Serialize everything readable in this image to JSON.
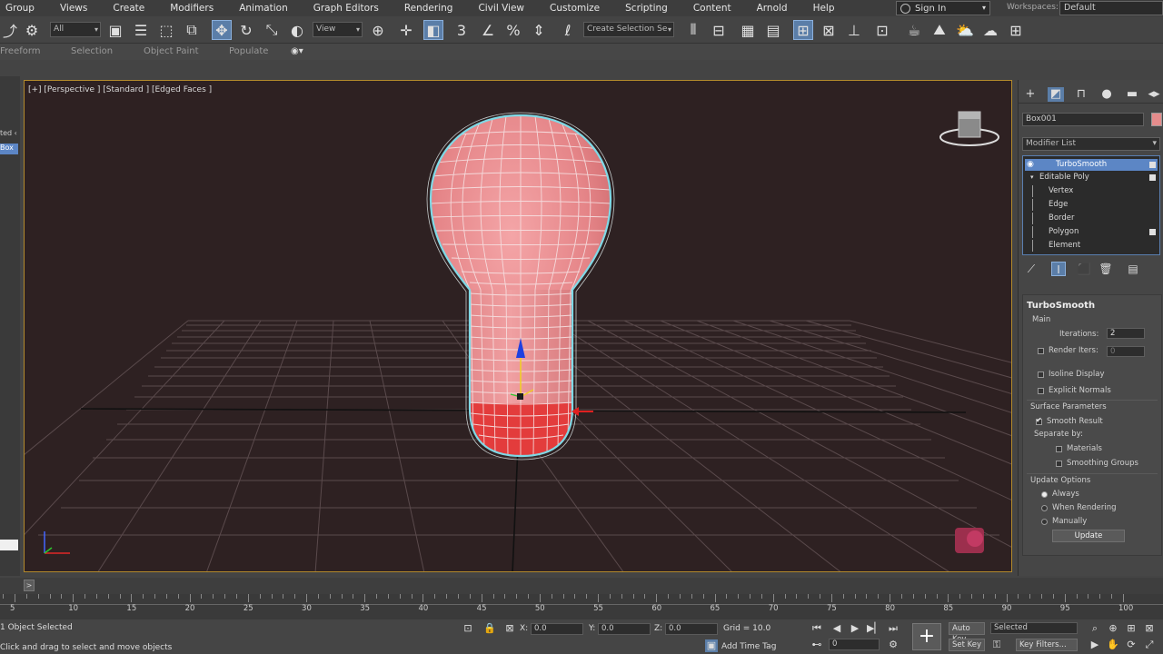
{
  "menu": [
    "Group",
    "Views",
    "Create",
    "Modifiers",
    "Animation",
    "Graph Editors",
    "Rendering",
    "Civil View",
    "Customize",
    "Scripting",
    "Content",
    "Arnold",
    "Help"
  ],
  "signin": "Sign In",
  "workspaces": {
    "label": "Workspaces:",
    "value": "Default"
  },
  "toolbar": {
    "filter": "All",
    "coord": "View",
    "selection_set": "Create Selection Se"
  },
  "ribbon": [
    "Freeform",
    "Selection",
    "Object Paint",
    "Populate"
  ],
  "viewport": {
    "label": "[+] [Perspective ] [Standard ] [Edged Faces ]"
  },
  "left_strip": {
    "text1": "ted ‹",
    "text2": "Box"
  },
  "command_panel": {
    "object_name": "Box001",
    "object_color": "#e58c8c",
    "modifier_list": "Modifier List",
    "stack": [
      {
        "label": "TurboSmooth",
        "selected": true
      },
      {
        "label": "Editable Poly",
        "selected": false
      },
      {
        "label": "Vertex",
        "selected": false
      },
      {
        "label": "Edge",
        "selected": false
      },
      {
        "label": "Border",
        "selected": false
      },
      {
        "label": "Polygon",
        "selected": false
      },
      {
        "label": "Element",
        "selected": false
      }
    ]
  },
  "turbosmooth": {
    "title": "TurboSmooth",
    "main": "Main",
    "iterations_label": "Iterations:",
    "iterations_value": "2",
    "render_iters_label": "Render Iters:",
    "render_iters_value": "0",
    "isoline": "Isoline Display",
    "explicit": "Explicit Normals",
    "surface_params": "Surface Parameters",
    "smooth_result": "Smooth Result",
    "separate_by": "Separate by:",
    "materials": "Materials",
    "smoothing_groups": "Smoothing Groups",
    "update_options": "Update Options",
    "always": "Always",
    "when_rendering": "When Rendering",
    "manually": "Manually",
    "update_btn": "Update"
  },
  "timeline": {
    "thumb": ">",
    "ticks": [
      "5",
      "10",
      "15",
      "20",
      "25",
      "30",
      "35",
      "40",
      "45",
      "50",
      "55",
      "60",
      "65",
      "70",
      "75",
      "80",
      "85",
      "90",
      "95",
      "100"
    ]
  },
  "status": {
    "selected": "1 Object Selected",
    "prompt": "Click and drag to select and move objects",
    "x_label": "X:",
    "x": "0.0",
    "y_label": "Y:",
    "y": "0.0",
    "z_label": "Z:",
    "z": "0.0",
    "grid": "Grid = 10.0",
    "add_time_tag": "Add Time Tag",
    "auto_key": "Auto Key",
    "set_key": "Set Key",
    "selected_dd": "Selected",
    "key_filters": "Key Filters...",
    "frame": "0"
  },
  "colors": {
    "viewport_bg": "#2e2122",
    "mesh_fill": "#e8888a",
    "mesh_wire": "#f4dfe0",
    "selection_outline": "#7fd9e6",
    "selected_faces": "#e03030",
    "active_border": "#b38a2c"
  }
}
